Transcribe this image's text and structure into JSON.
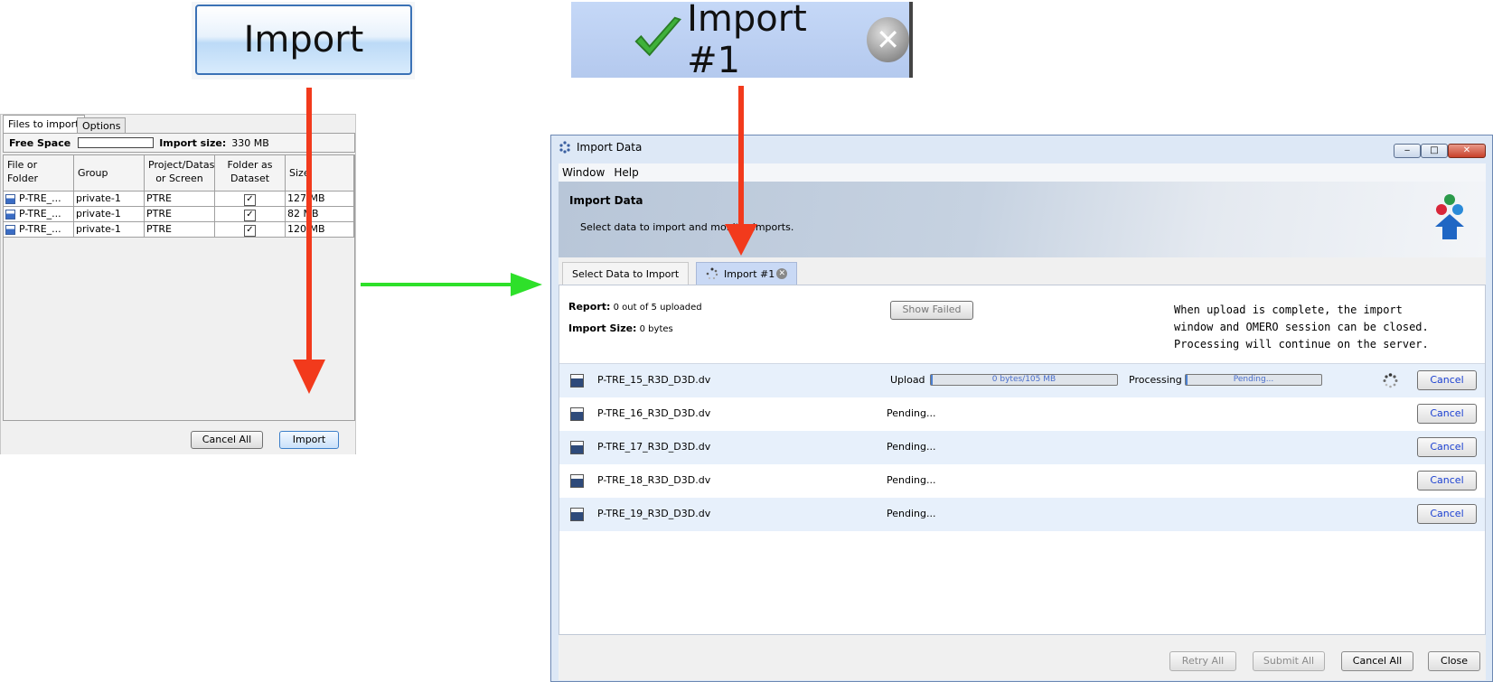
{
  "zoom": {
    "import_button_label": "Import",
    "tab_label": "Import #1"
  },
  "left_dialog": {
    "tabs": [
      "Files to import",
      "Options"
    ],
    "free_space_label": "Free Space",
    "import_size_label": "Import size:",
    "import_size_value": "330 MB",
    "columns": [
      "File or Folder",
      "Group",
      "Project/Dataset or Screen",
      "Folder as Dataset",
      "Size"
    ],
    "rows": [
      {
        "file": "P-TRE_...",
        "group": "private-1",
        "project": "PTRE",
        "folder_as_dataset": "✓",
        "size": "127 MB"
      },
      {
        "file": "P-TRE_...",
        "group": "private-1",
        "project": "PTRE",
        "folder_as_dataset": "✓",
        "size": "82 MB"
      },
      {
        "file": "P-TRE_...",
        "group": "private-1",
        "project": "PTRE",
        "folder_as_dataset": "✓",
        "size": "120 MB"
      }
    ],
    "cancel_all_label": "Cancel All",
    "import_label": "Import"
  },
  "main_window": {
    "title": "Import Data",
    "window_buttons": [
      "‒",
      "□",
      "✕"
    ],
    "menu": [
      "Window",
      "Help"
    ],
    "banner_title": "Import Data",
    "banner_subtitle": "Select data to import and monitor imports.",
    "tabs": [
      "Select Data to Import",
      "Import #1"
    ],
    "report_label": "Report:",
    "report_value": "0 out of 5 uploaded",
    "import_size_label": "Import Size:",
    "import_size_value": "0 bytes",
    "show_failed_label": "Show Failed",
    "note": "When upload is complete, the import\nwindow and OMERO session can be closed.\nProcessing will continue on the server.",
    "files": [
      {
        "name": "P-TRE_15_R3D_D3D.dv",
        "status": "",
        "upload_label": "Upload",
        "upload_text": "0 bytes/105 MB",
        "processing_label": "Processing",
        "processing_text": "Pending...",
        "cancel": "Cancel"
      },
      {
        "name": "P-TRE_16_R3D_D3D.dv",
        "status": "Pending...",
        "cancel": "Cancel"
      },
      {
        "name": "P-TRE_17_R3D_D3D.dv",
        "status": "Pending...",
        "cancel": "Cancel"
      },
      {
        "name": "P-TRE_18_R3D_D3D.dv",
        "status": "Pending...",
        "cancel": "Cancel"
      },
      {
        "name": "P-TRE_19_R3D_D3D.dv",
        "status": "Pending...",
        "cancel": "Cancel"
      }
    ],
    "footer_buttons": {
      "retry_all": "Retry All",
      "submit_all": "Submit All",
      "cancel_all": "Cancel All",
      "close": "Close"
    }
  },
  "colors": {
    "arrow_red": "#f23a1c",
    "arrow_green": "#2ee02a",
    "cancel_text": "#1a3fd1",
    "progress_fill": "#4a7fd0"
  }
}
